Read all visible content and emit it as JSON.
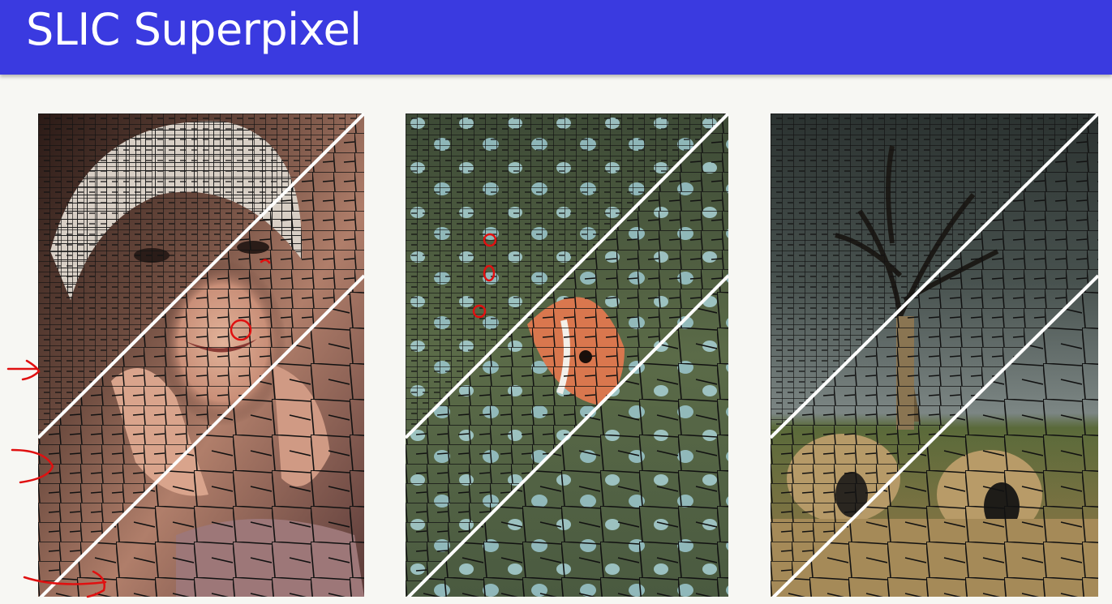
{
  "slide": {
    "title": "SLIC Superpixel"
  },
  "colors": {
    "title_bar": "#3a3ae0",
    "title_text": "#ffffff",
    "slide_background": "#f7f7f3",
    "annotation_ink": "#e01010",
    "superpixel_boundary": "#111111",
    "diagonal_separator": "#ffffff"
  },
  "images": [
    {
      "name": "portrait",
      "description_icon": "woman-portrait-superpixel-image"
    },
    {
      "name": "clownfish",
      "description_icon": "clownfish-anemone-superpixel-image"
    },
    {
      "name": "tree",
      "description_icon": "tree-and-huts-superpixel-image"
    }
  ],
  "annotations": {
    "arrows": 3,
    "circles": 4
  }
}
